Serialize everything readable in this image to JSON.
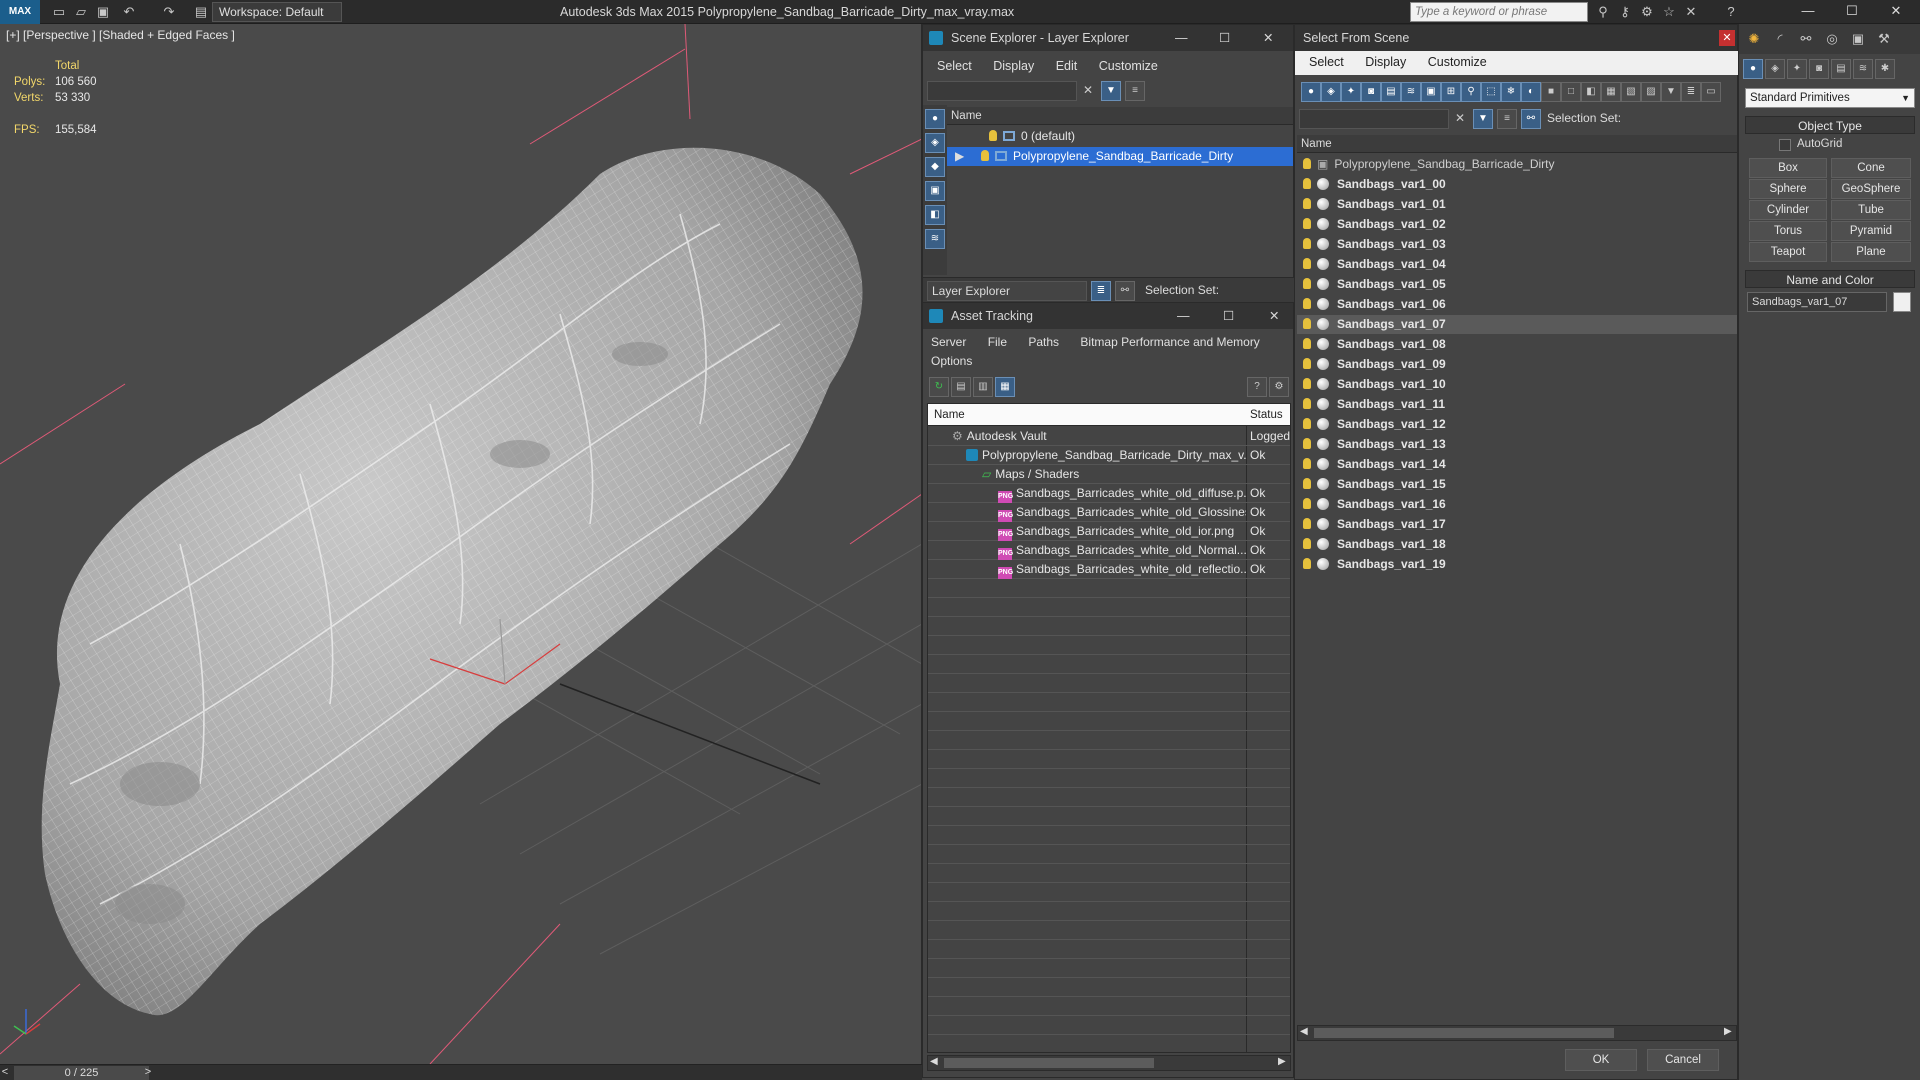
{
  "titlebar": {
    "logo": "MAX",
    "workspace": "Workspace: Default",
    "app_title": "Autodesk 3ds Max  2015     Polypropylene_Sandbag_Barricade_Dirty_max_vray.max",
    "search_placeholder": "Type a keyword or phrase"
  },
  "viewport": {
    "label": "[+] [Perspective ] [Shaded + Edged Faces ]",
    "stats_header": "Total",
    "polys_label": "Polys:",
    "polys_value": "106 560",
    "verts_label": "Verts:",
    "verts_value": "53 330",
    "fps_label": "FPS:",
    "fps_value": "155,584"
  },
  "timeline": {
    "frame": "0 / 225",
    "prev": "<",
    "next": ">"
  },
  "scene_explorer": {
    "title": "Scene Explorer - Layer Explorer",
    "menu": [
      "Select",
      "Display",
      "Edit",
      "Customize"
    ],
    "column_name": "Name",
    "layers": [
      {
        "label": "0 (default)"
      },
      {
        "label": "Polypropylene_Sandbag_Barricade_Dirty"
      }
    ],
    "footer_mode": "Layer Explorer",
    "selection_set_label": "Selection Set:"
  },
  "asset_tracking": {
    "title": "Asset Tracking",
    "menu": [
      "Server",
      "File",
      "Paths",
      "Bitmap Performance and Memory"
    ],
    "menu2": "Options",
    "col_name": "Name",
    "col_status": "Status",
    "rows": [
      {
        "name": "Autodesk Vault",
        "status": "Logged"
      },
      {
        "name": "Polypropylene_Sandbag_Barricade_Dirty_max_v...",
        "status": "Ok"
      },
      {
        "name": "Maps / Shaders",
        "status": ""
      },
      {
        "name": "Sandbags_Barricades_white_old_diffuse.p...",
        "status": "Ok"
      },
      {
        "name": "Sandbags_Barricades_white_old_Glossines...",
        "status": "Ok"
      },
      {
        "name": "Sandbags_Barricades_white_old_ior.png",
        "status": "Ok"
      },
      {
        "name": "Sandbags_Barricades_white_old_Normal....",
        "status": "Ok"
      },
      {
        "name": "Sandbags_Barricades_white_old_reflectio...",
        "status": "Ok"
      }
    ]
  },
  "select_from_scene": {
    "title": "Select From Scene",
    "menu": [
      "Select",
      "Display",
      "Customize"
    ],
    "selection_set_label": "Selection Set:",
    "column_name": "Name",
    "root": "Polypropylene_Sandbag_Barricade_Dirty",
    "objects": [
      "Sandbags_var1_00",
      "Sandbags_var1_01",
      "Sandbags_var1_02",
      "Sandbags_var1_03",
      "Sandbags_var1_04",
      "Sandbags_var1_05",
      "Sandbags_var1_06",
      "Sandbags_var1_07",
      "Sandbags_var1_08",
      "Sandbags_var1_09",
      "Sandbags_var1_10",
      "Sandbags_var1_11",
      "Sandbags_var1_12",
      "Sandbags_var1_13",
      "Sandbags_var1_14",
      "Sandbags_var1_15",
      "Sandbags_var1_16",
      "Sandbags_var1_17",
      "Sandbags_var1_18",
      "Sandbags_var1_19"
    ],
    "highlighted_index": 7,
    "ok": "OK",
    "cancel": "Cancel"
  },
  "command_panel": {
    "dropdown": "Standard Primitives",
    "object_type_header": "Object Type",
    "autogrid": "AutoGrid",
    "buttons": [
      "Box",
      "Cone",
      "Sphere",
      "GeoSphere",
      "Cylinder",
      "Tube",
      "Torus",
      "Pyramid",
      "Teapot",
      "Plane"
    ],
    "name_color_header": "Name and Color",
    "name_value": "Sandbags_var1_07",
    "color_swatch": "#f0f0f0"
  },
  "colors": {
    "selection_blue": "#2c6dd3",
    "stats_yellow": "#f2d76a",
    "wireframe": "#d9d9d9"
  }
}
